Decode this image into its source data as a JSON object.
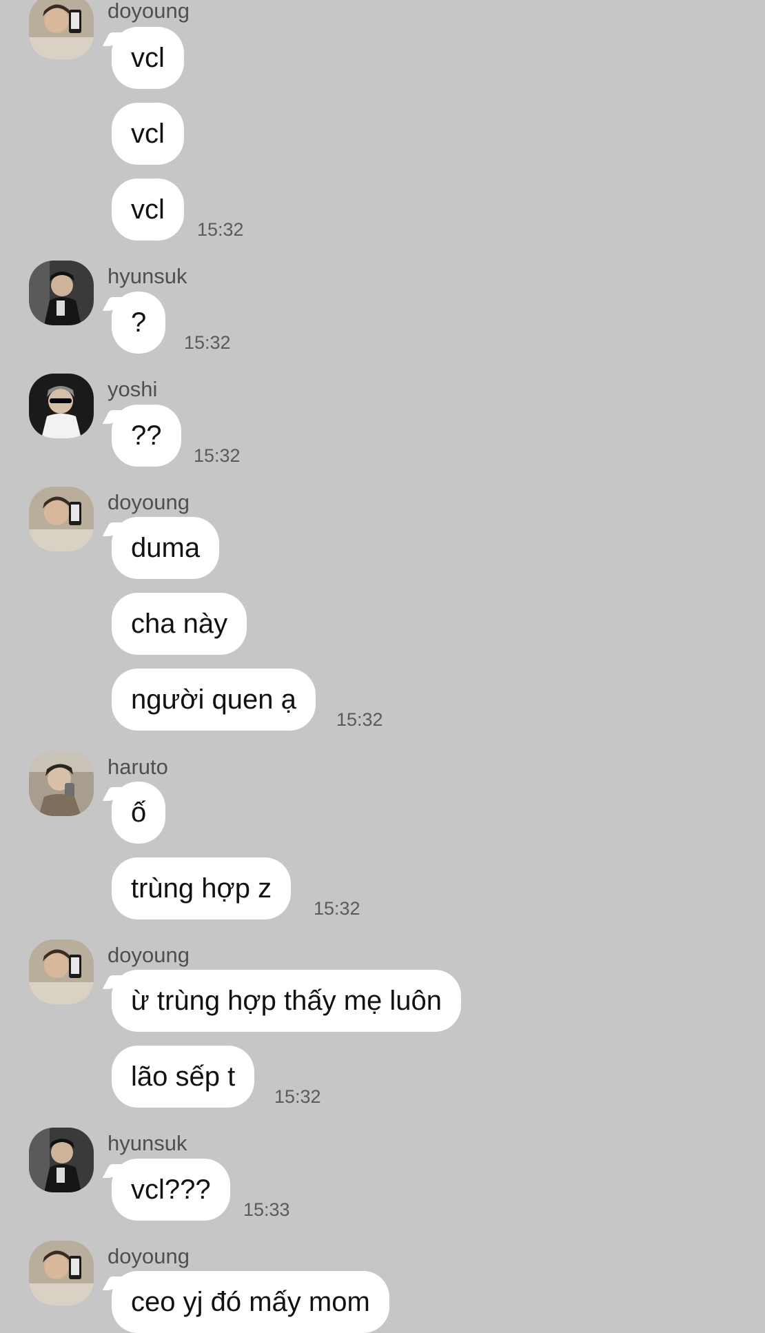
{
  "colors": {
    "background": "#c6c6c6",
    "bubble": "#ffffff",
    "name_text": "#4f4f4f",
    "time_text": "#5a5a5a"
  },
  "groups": [
    {
      "sender": "doyoung",
      "avatar_icon": "doyoung-avatar-icon",
      "messages": [
        "vcl",
        "vcl",
        "vcl"
      ],
      "time": "15:32"
    },
    {
      "sender": "hyunsuk",
      "avatar_icon": "hyunsuk-avatar-icon",
      "messages": [
        "?"
      ],
      "time": "15:32"
    },
    {
      "sender": "yoshi",
      "avatar_icon": "yoshi-avatar-icon",
      "messages": [
        "??"
      ],
      "time": "15:32"
    },
    {
      "sender": "doyoung",
      "avatar_icon": "doyoung-avatar-icon",
      "messages": [
        "duma",
        "cha này",
        "người quen ạ"
      ],
      "time": "15:32"
    },
    {
      "sender": "haruto",
      "avatar_icon": "haruto-avatar-icon",
      "messages": [
        "ố",
        "trùng hợp z"
      ],
      "time": "15:32"
    },
    {
      "sender": "doyoung",
      "avatar_icon": "doyoung-avatar-icon",
      "messages": [
        "ừ trùng hợp thấy mẹ luôn",
        "lão sếp t"
      ],
      "time": "15:32"
    },
    {
      "sender": "hyunsuk",
      "avatar_icon": "hyunsuk-avatar-icon",
      "messages": [
        "vcl???"
      ],
      "time": "15:33"
    },
    {
      "sender": "doyoung",
      "avatar_icon": "doyoung-avatar-icon",
      "messages": [
        "ceo yj đó mấy mom"
      ],
      "time": ""
    }
  ]
}
